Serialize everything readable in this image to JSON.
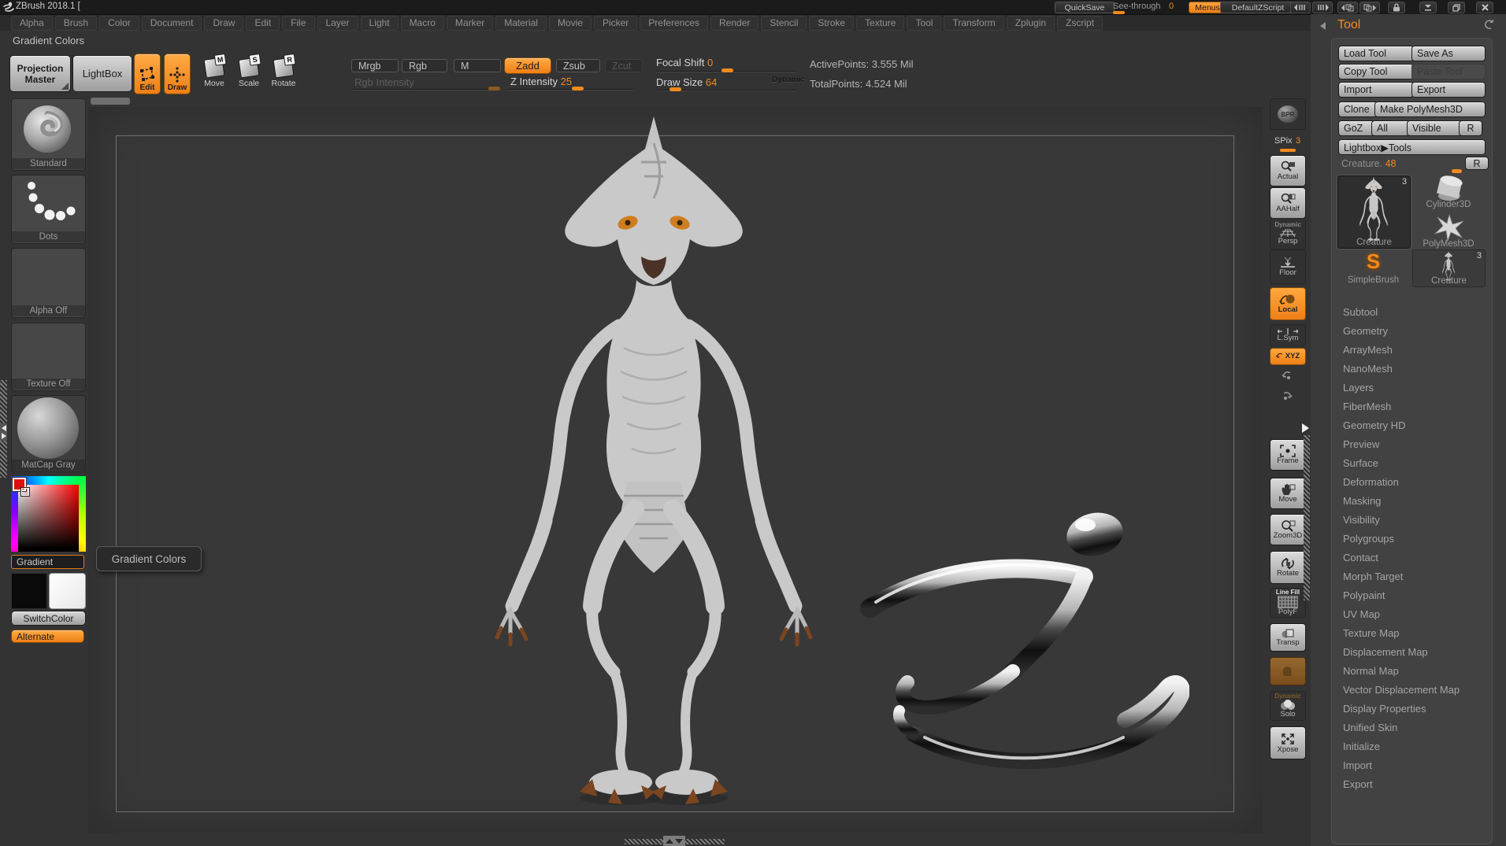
{
  "colors": {
    "accent": "#f28a1e",
    "canvas": "#383838",
    "panel": "#424242"
  },
  "title_bar": {
    "app_title": "ZBrush 2018.1 [",
    "quicksave": "QuickSave",
    "see_through_label": "See-through",
    "see_through_value": "0",
    "menus_button": "Menus",
    "zscript_button": "DefaultZScript"
  },
  "menu_bar": {
    "items": [
      "Alpha",
      "Brush",
      "Color",
      "Document",
      "Draw",
      "Edit",
      "File",
      "Layer",
      "Light",
      "Macro",
      "Marker",
      "Material",
      "Movie",
      "Picker",
      "Preferences",
      "Render",
      "Stencil",
      "Stroke",
      "Texture",
      "Tool",
      "Transform",
      "Zplugin",
      "Zscript"
    ]
  },
  "status_hint": "Gradient Colors",
  "toolbar": {
    "projection_master": "Projection Master",
    "lightbox": "LightBox",
    "edit": "Edit",
    "draw": "Draw",
    "move": "Move",
    "move_badge": "M",
    "scale": "Scale",
    "scale_badge": "S",
    "rotate": "Rotate",
    "rotate_badge": "R",
    "mrgb": "Mrgb",
    "rgb": "Rgb",
    "m": "M",
    "zadd": "Zadd",
    "zsub": "Zsub",
    "zcut": "Zcut",
    "rgb_intensity": "Rgb Intensity",
    "z_intensity_label": "Z Intensity",
    "z_intensity_value": "25",
    "focal_shift_label": "Focal Shift",
    "focal_shift_value": "0",
    "draw_size_label": "Draw Size",
    "draw_size_value": "64",
    "dynamic_label": "Dynamic",
    "active_points": "ActivePoints: 3.555 Mil",
    "total_points": "TotalPoints: 4.524 Mil"
  },
  "left_tray": {
    "items": [
      {
        "label": "Standard"
      },
      {
        "label": "Dots"
      },
      {
        "label": "Alpha Off"
      },
      {
        "label": "Texture Off"
      },
      {
        "label": "MatCap Gray"
      }
    ],
    "gradient_button": "Gradient",
    "switch_color": "SwitchColor",
    "alternate": "Alternate"
  },
  "tooltip": {
    "text": "Gradient Colors"
  },
  "right_shelf": {
    "items": [
      {
        "label": "BPR"
      },
      {
        "label": "SPix",
        "value": "3"
      },
      {
        "label": "Actual"
      },
      {
        "label": "AAHalf"
      },
      {
        "top": "Dynamic",
        "label": "Persp"
      },
      {
        "label": "Floor"
      },
      {
        "label": "Local"
      },
      {
        "label": "L.Sym"
      },
      {
        "label": "XYZ"
      },
      {
        "label": ""
      },
      {
        "label": ""
      },
      {
        "label": "Frame"
      },
      {
        "label": "Move"
      },
      {
        "label": "Zoom3D"
      },
      {
        "label": "Rotate"
      },
      {
        "top": "Line Fill",
        "label": "PolyF"
      },
      {
        "label": "Transp"
      },
      {
        "label": ""
      },
      {
        "top": "Dynamic",
        "label": "Solo"
      },
      {
        "label": "Xpose"
      }
    ]
  },
  "right_panel": {
    "header": "Tool",
    "load_tool": "Load Tool",
    "save_as": "Save As",
    "copy_tool": "Copy Tool",
    "paste_tool": "Paste Tool",
    "import": "Import",
    "export": "Export",
    "clone": "Clone",
    "make_polymesh": "Make PolyMesh3D",
    "goz": "GoZ",
    "all": "All",
    "visible": "Visible",
    "r": "R",
    "lightbox_tools": "Lightbox▶Tools",
    "tool_name": "Creature.",
    "tool_value": "48",
    "thumbnails": [
      {
        "label": "Creature",
        "badge": "3"
      },
      {
        "label": "Cylinder3D",
        "badge": ""
      },
      {
        "label": "PolyMesh3D",
        "badge": ""
      },
      {
        "label": "SimpleBrush",
        "badge": ""
      },
      {
        "label": "Creature",
        "badge": "3"
      }
    ],
    "sections": [
      "Subtool",
      "Geometry",
      "ArrayMesh",
      "NanoMesh",
      "Layers",
      "FiberMesh",
      "Geometry HD",
      "Preview",
      "Surface",
      "Deformation",
      "Masking",
      "Visibility",
      "Polygroups",
      "Contact",
      "Morph Target",
      "Polypaint",
      "UV Map",
      "Texture Map",
      "Displacement Map",
      "Normal Map",
      "Vector Displacement Map",
      "Display Properties",
      "Unified Skin",
      "Initialize",
      "Import",
      "Export"
    ]
  }
}
